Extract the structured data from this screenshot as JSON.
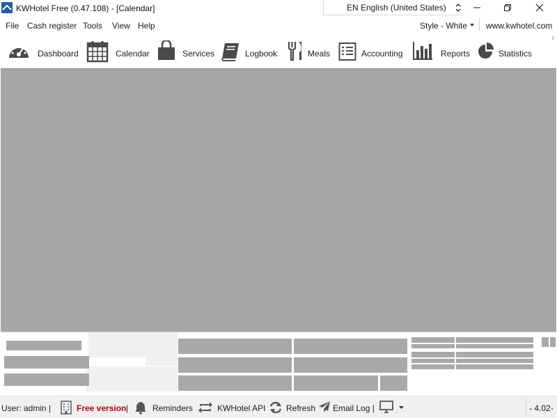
{
  "window": {
    "title": "KWHotel Free (0.47.108) - [Calendar]",
    "language": "EN English (United States)"
  },
  "menu": {
    "items": [
      "File",
      "Cash register",
      "Tools",
      "View",
      "Help"
    ],
    "style_label": "Style - White",
    "site": "www.kwhotel.com"
  },
  "toolbar": {
    "items": [
      {
        "label": "Dashboard",
        "icon": "dashboard-gauge-icon"
      },
      {
        "label": "Calendar",
        "icon": "calendar-icon"
      },
      {
        "label": "Services",
        "icon": "shopping-bag-icon"
      },
      {
        "label": "Logbook",
        "icon": "book-icon"
      },
      {
        "label": "Meals",
        "icon": "fork-knife-icon"
      },
      {
        "label": "Accounting",
        "icon": "ledger-icon"
      },
      {
        "label": "Reports",
        "icon": "bar-chart-icon"
      },
      {
        "label": "Statistics",
        "icon": "pie-chart-icon"
      }
    ]
  },
  "status": {
    "user": "User: admin |",
    "free_version": "Free version",
    "free_sep": "|",
    "reminders": "Reminders",
    "api": "KWHotel API",
    "refresh": "Refresh",
    "email_log": "Email Log |",
    "version_value": "- 4.02",
    "version_dash": "-"
  },
  "colors": {
    "main_area": "#a6a6a6",
    "placeholder_block": "#a9a9a9",
    "free_version_text": "#b40000",
    "icon_gray": "#4a4a4a"
  }
}
